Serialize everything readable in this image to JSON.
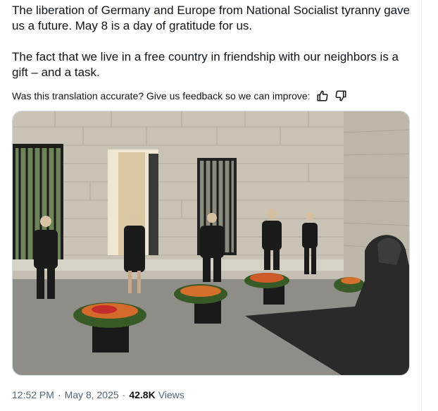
{
  "tweet": {
    "paragraphs": [
      "The liberation of Germany and Europe from National Socialist tyranny gave us a future. May 8 is a day of gratitude for us.",
      "The fact that we live in a free country in friendship with our neighbors is a gift – and a task."
    ]
  },
  "translation_feedback": {
    "prompt": "Was this translation accurate? Give us feedback so we can improve:",
    "icons": [
      "thumbs-up-icon",
      "thumbs-down-icon"
    ]
  },
  "photo": {
    "subject": "memorial-wreaths-neue-wache"
  },
  "meta": {
    "time": "12:52 PM",
    "separator": "·",
    "date": "May 8, 2025",
    "views_count": "42.8K",
    "views_label": "Views"
  },
  "colors": {
    "text": "#0f1419",
    "secondary": "#536471",
    "border": "#cfd9de"
  }
}
